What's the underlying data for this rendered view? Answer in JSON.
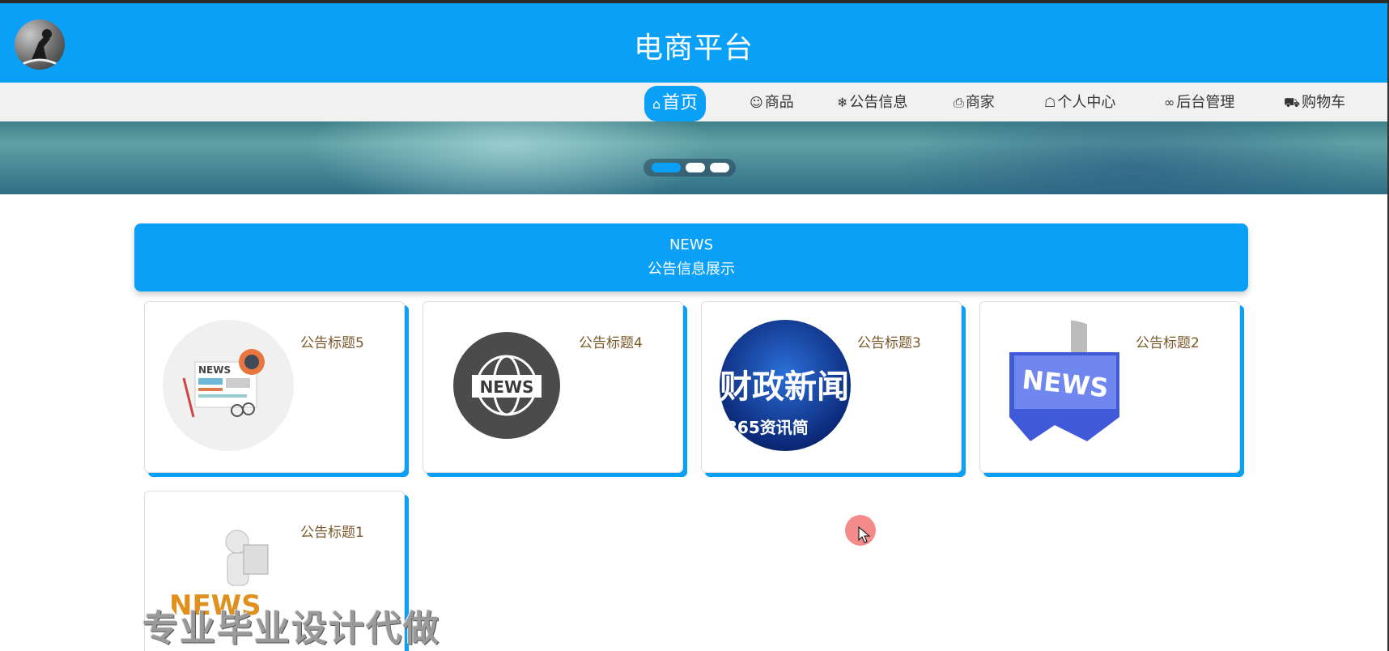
{
  "header": {
    "title": "电商平台",
    "avatar_icon": "user-avatar"
  },
  "nav": {
    "items": [
      {
        "label": "首页",
        "icon": "home-icon",
        "glyph": "⌂",
        "active": true
      },
      {
        "label": "商品",
        "icon": "goods-icon",
        "glyph": "☺"
      },
      {
        "label": "公告信息",
        "icon": "snowflake-icon",
        "glyph": "❄"
      },
      {
        "label": "商家",
        "icon": "printer-icon",
        "glyph": "⎙"
      },
      {
        "label": "个人中心",
        "icon": "person-icon",
        "glyph": "☖"
      },
      {
        "label": "后台管理",
        "icon": "link-icon",
        "glyph": "∞"
      },
      {
        "label": "购物车",
        "icon": "cart-icon",
        "glyph": "⛟"
      }
    ]
  },
  "banner": {
    "slides": 3,
    "active_slide": 1
  },
  "news": {
    "en_title": "NEWS",
    "cn_title": "公告信息展示",
    "cards": [
      {
        "title": "公告标题5",
        "image": "newspaper-illustration"
      },
      {
        "title": "公告标题4",
        "image": "news-globe-icon",
        "image_text": "NEWS"
      },
      {
        "title": "公告标题3",
        "image": "finance-news-banner",
        "image_text": "财政新闻",
        "image_subtext": "365资讯简"
      },
      {
        "title": "公告标题2",
        "image": "news-keyboard-key",
        "image_text": "NEWS"
      },
      {
        "title": "公告标题1",
        "image": "3d-man-reading-news",
        "image_text": "NEWS"
      }
    ]
  },
  "watermark": "专业毕业设计代做",
  "colors": {
    "primary": "#0aa0f8",
    "nav_bg": "#f1f1f1",
    "title_text": "#7a5a2a"
  }
}
